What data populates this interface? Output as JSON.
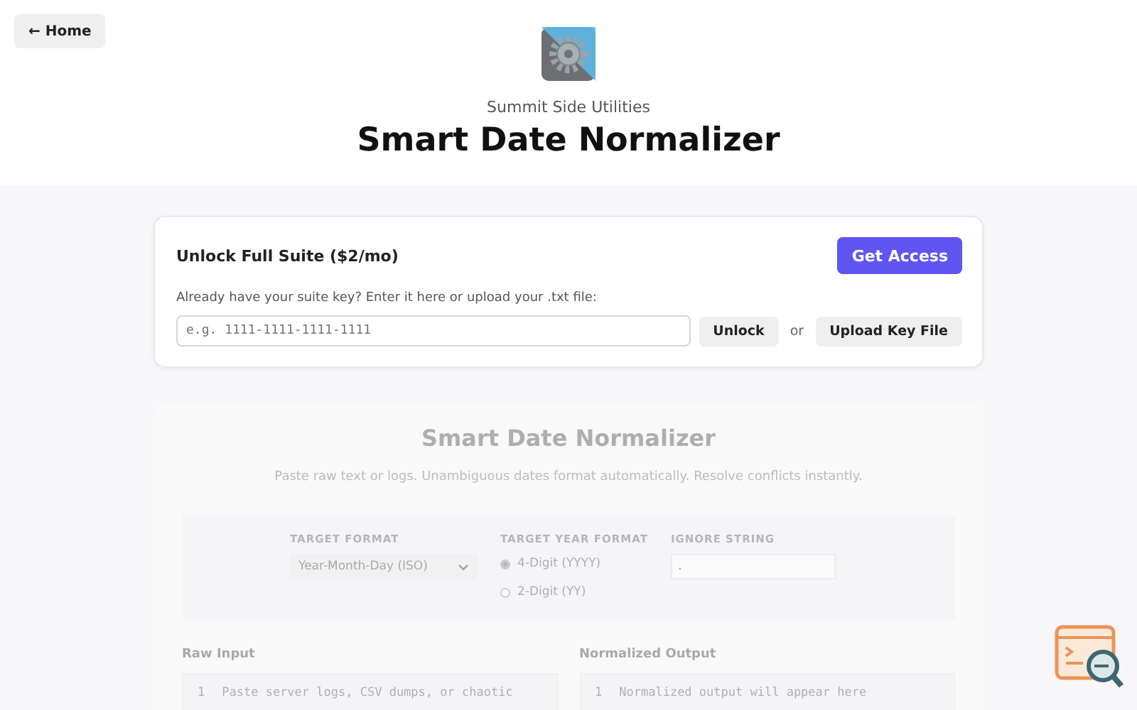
{
  "home_button": "← Home",
  "header": {
    "brand": "Summit Side Utilities",
    "title": "Smart Date Normalizer"
  },
  "unlock_card": {
    "title": "Unlock Full Suite ($2/mo)",
    "access_button": "Get Access",
    "hint": "Already have your suite key? Enter it here or upload your .txt file:",
    "key_field": {
      "placeholder": "e.g. 1111-1111-1111-1111"
    },
    "unlock_button": "Unlock",
    "separator": "or",
    "upload_button": "Upload Key File"
  },
  "tool": {
    "locked": true,
    "title": "Smart Date Normalizer",
    "subtitle": "Paste raw text or logs. Unambiguous dates format automatically. Resolve conflicts instantly.",
    "target_format": {
      "label": "TARGET FORMAT",
      "value": "Year-Month-Day (ISO)"
    },
    "year_format": {
      "label": "TARGET YEAR FORMAT",
      "options": [
        {
          "label": "4-Digit (YYYY)",
          "selected": true
        },
        {
          "label": "2-Digit (YY)",
          "selected": false
        }
      ]
    },
    "ignore_string": {
      "label": "IGNORE STRING",
      "value": "."
    },
    "panes": [
      {
        "label": "Raw Input",
        "line_number": "1",
        "text": "Paste server logs, CSV dumps, or chaotic"
      },
      {
        "label": "Normalized Output",
        "line_number": "1",
        "text": "Normalized output will appear here"
      }
    ]
  }
}
